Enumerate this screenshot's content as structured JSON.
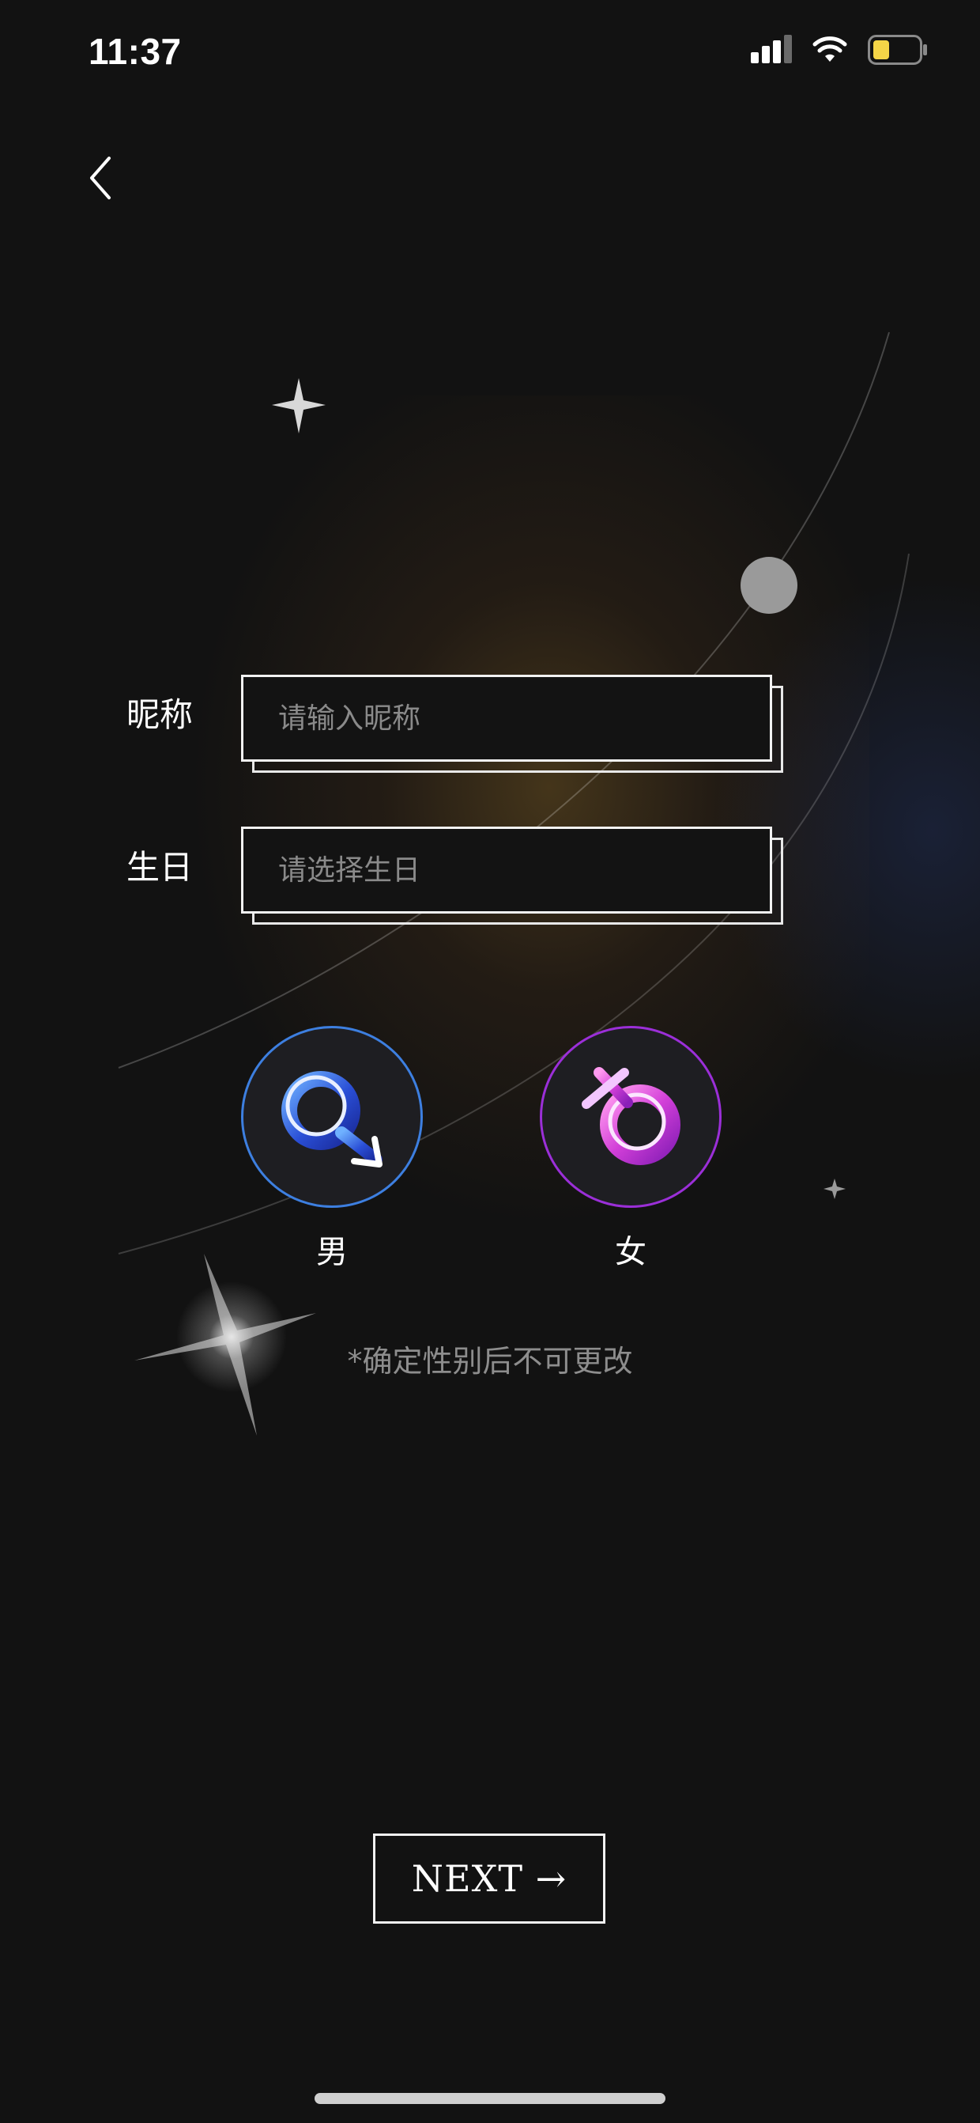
{
  "status_bar": {
    "time": "11:37"
  },
  "form": {
    "nickname": {
      "label": "昵称",
      "placeholder": "请输入昵称",
      "value": ""
    },
    "birthday": {
      "label": "生日",
      "placeholder": "请选择生日",
      "value": ""
    }
  },
  "gender": {
    "male_label": "男",
    "female_label": "女",
    "hint": "*确定性别后不可更改"
  },
  "next_button": {
    "label": "NEXT →"
  },
  "colors": {
    "background": "#121212",
    "male_accent": "#3d7fe0",
    "female_accent": "#9b2fd8",
    "battery": "#f5d547"
  },
  "icons": [
    "back-chevron-icon",
    "signal-icon",
    "wifi-icon",
    "battery-icon",
    "male-symbol-icon",
    "female-symbol-icon"
  ]
}
